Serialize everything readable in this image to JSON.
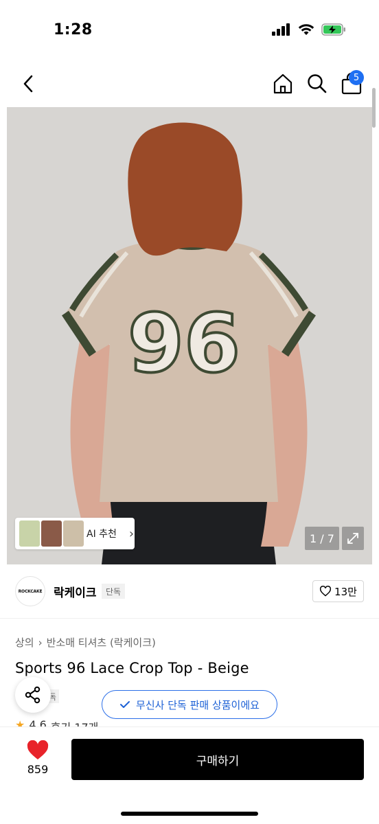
{
  "status_bar": {
    "time": "1:28"
  },
  "nav": {
    "back_icon": "chevron-left-icon",
    "home_icon": "home-icon",
    "search_icon": "search-icon",
    "cart_icon": "shopping-bag-icon",
    "cart_count": "5"
  },
  "gallery": {
    "ai_recommend_label": "AI 추천",
    "page_indicator": "1 / 7",
    "expand_icon": "expand-icon"
  },
  "brand": {
    "logo_text": "ROCKCAKE",
    "name": "락케이크",
    "badge": "단독",
    "like_count": "13만"
  },
  "product": {
    "breadcrumb": [
      "상의",
      "반소매 티셔츠 (락케이크)"
    ],
    "title": "Sports 96 Lace Crop Top - Beige",
    "tag": "단독",
    "rating": "4.6",
    "reviews": "후기 17개"
  },
  "toast": {
    "text": "무신사 단독 판매 상품이에요"
  },
  "bottom": {
    "wish_count": "859",
    "buy_label": "구매하기"
  },
  "colors": {
    "accent_blue": "#1e6ff2",
    "heart_red": "#e8232a",
    "buy_black": "#000000"
  }
}
